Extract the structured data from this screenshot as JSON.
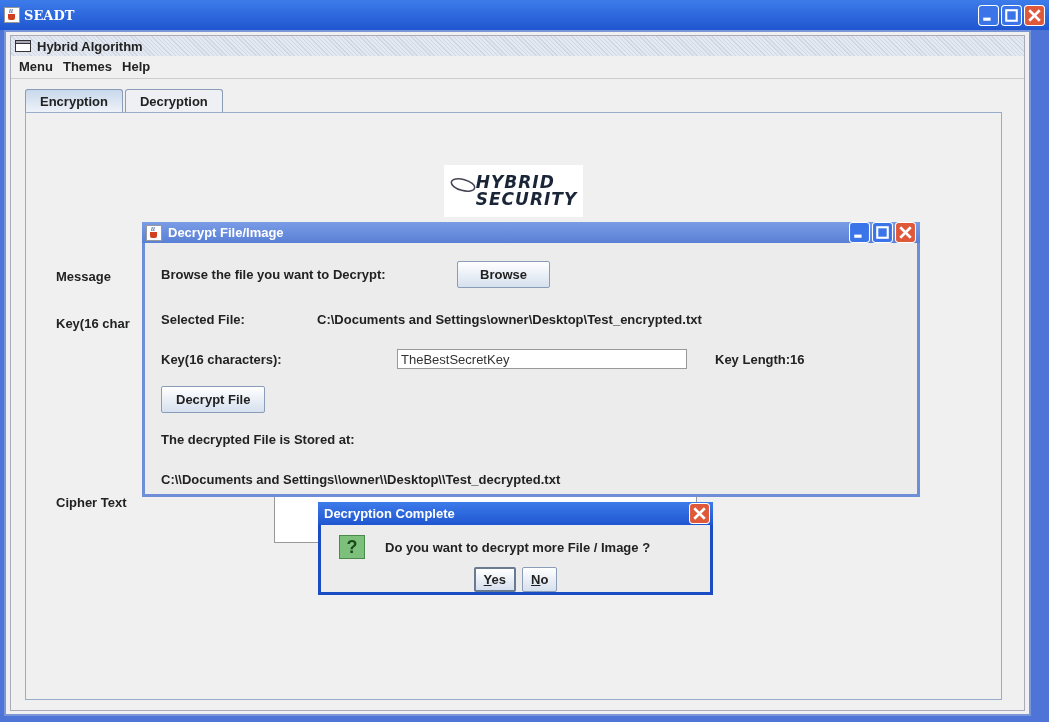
{
  "window": {
    "title": "SEADT"
  },
  "internal_frame": {
    "title": "Hybrid Algorithm"
  },
  "menu": [
    {
      "label": "Menu"
    },
    {
      "label": "Themes"
    },
    {
      "label": "Help"
    }
  ],
  "tabs": [
    {
      "label": "Encryption",
      "selected": true
    },
    {
      "label": "Decryption",
      "selected": false
    }
  ],
  "logo": {
    "lines": [
      "HYBRID",
      "SECURITY"
    ]
  },
  "form": {
    "message_label": "Message",
    "key_label": "Key(16 char",
    "cipher_label": "Cipher Text"
  },
  "decrypt_window": {
    "title": "Decrypt File/Image",
    "browse_label": "Browse the file you want to Decrypt:",
    "browse_button": "Browse",
    "selected_label": "Selected File:",
    "selected_path": "C:\\Documents and Settings\\owner\\Desktop\\Test_encrypted.txt",
    "key_label": "Key(16 characters):",
    "key_value": "TheBestSecretKey",
    "key_length": "Key Length:16",
    "decrypt_button": "Decrypt File",
    "stored_label": "The decrypted File is Stored at:",
    "stored_path": "C:\\\\Documents and Settings\\\\owner\\\\Desktop\\\\Test_decrypted.txt"
  },
  "dialog": {
    "title": "Decryption Complete",
    "icon": "?",
    "message": "Do you want to decrypt more File / Image ?",
    "buttons": [
      {
        "mnemonic": "Y",
        "rest": "es",
        "selected": true
      },
      {
        "mnemonic": "N",
        "rest": "o",
        "selected": false
      }
    ]
  }
}
